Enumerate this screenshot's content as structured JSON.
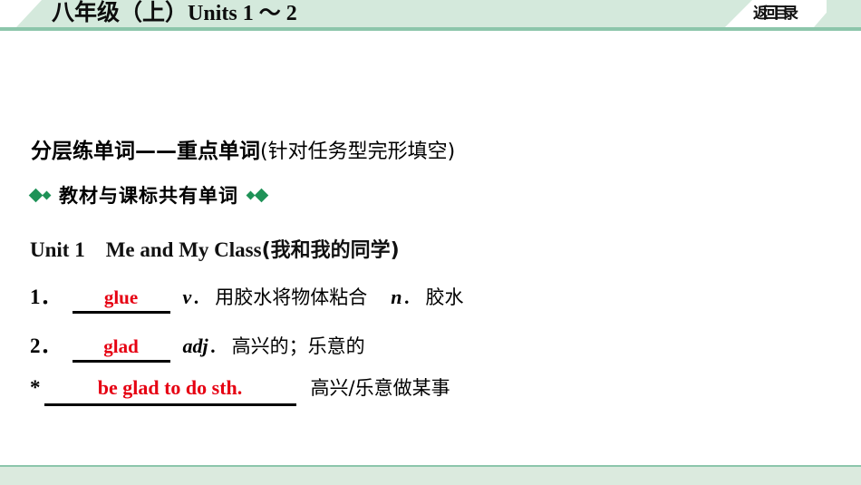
{
  "header": {
    "title_cn": "八年级（上）",
    "title_units": "Units 1 ～ 2",
    "back_label": "返回目录",
    "band_color": "#d4e9dc",
    "rule_color": "#8cc6ab"
  },
  "main": {
    "section_title_strong": "分层练单词——重点单词",
    "section_title_paren": "(针对任务型完形填空)",
    "subsection_label": "教材与课标共有单词",
    "diamond_color": "#1f9257",
    "unit_en": "Unit 1　Me and My Class",
    "unit_cn": "(我和我的同学)",
    "answer_color": "#e60012",
    "entries": [
      {
        "index": "1．",
        "answer": "glue",
        "pos": "v",
        "pos_dot": "．",
        "meaning": "用胶水将物体粘合",
        "pos2": "n",
        "pos2_dot": "．",
        "meaning2": "胶水"
      },
      {
        "index": "2．",
        "answer": "glad",
        "pos": "adj",
        "pos_dot": "．",
        "meaning": "高兴的；乐意的"
      },
      {
        "index": "*",
        "answer": "be glad to do sth.",
        "meaning": "高兴/乐意做某事"
      }
    ]
  },
  "footer": {
    "band_color": "#dbeade",
    "rule_color": "#8cc6ab"
  }
}
